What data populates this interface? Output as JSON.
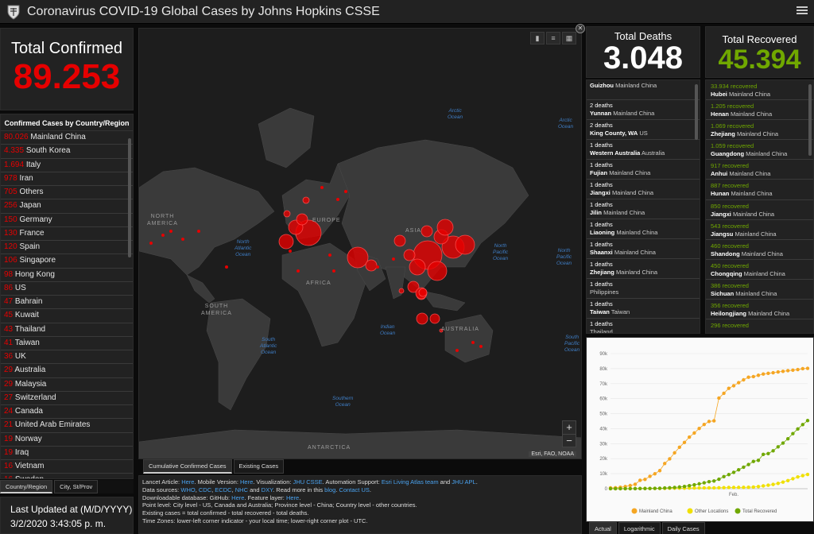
{
  "header": {
    "title": "Coronavirus COVID-19 Global Cases by Johns Hopkins CSSE",
    "menu_icon": "hamburger-icon"
  },
  "total_confirmed": {
    "label": "Total Confirmed",
    "value": "89.253"
  },
  "country_list": {
    "header": "Confirmed Cases by Country/Region",
    "items": [
      {
        "count": "80.026",
        "name": "Mainland China"
      },
      {
        "count": "4.335",
        "name": "South Korea"
      },
      {
        "count": "1.694",
        "name": "Italy"
      },
      {
        "count": "978",
        "name": "Iran"
      },
      {
        "count": "705",
        "name": "Others"
      },
      {
        "count": "256",
        "name": "Japan"
      },
      {
        "count": "150",
        "name": "Germany"
      },
      {
        "count": "130",
        "name": "France"
      },
      {
        "count": "120",
        "name": "Spain"
      },
      {
        "count": "106",
        "name": "Singapore"
      },
      {
        "count": "98",
        "name": "Hong Kong"
      },
      {
        "count": "86",
        "name": "US"
      },
      {
        "count": "47",
        "name": "Bahrain"
      },
      {
        "count": "45",
        "name": "Kuwait"
      },
      {
        "count": "43",
        "name": "Thailand"
      },
      {
        "count": "41",
        "name": "Taiwan"
      },
      {
        "count": "36",
        "name": "UK"
      },
      {
        "count": "29",
        "name": "Australia"
      },
      {
        "count": "29",
        "name": "Malaysia"
      },
      {
        "count": "27",
        "name": "Switzerland"
      },
      {
        "count": "24",
        "name": "Canada"
      },
      {
        "count": "21",
        "name": "United Arab Emirates"
      },
      {
        "count": "19",
        "name": "Norway"
      },
      {
        "count": "19",
        "name": "Iraq"
      },
      {
        "count": "16",
        "name": "Vietnam"
      },
      {
        "count": "16",
        "name": "Sweden"
      }
    ]
  },
  "left_tabs": [
    "Country/Region",
    "City, St/Prov"
  ],
  "last_updated": {
    "label": "Last Updated at (M/D/YYYY)",
    "value": "3/2/2020 3:43:05 p. m."
  },
  "map": {
    "labels": {
      "north_america": "NORTH\nAMERICA",
      "south_america": "SOUTH\nAMERICA",
      "europe": "EUROPE",
      "africa": "AFRICA",
      "asia": "ASIA",
      "australia": "AUSTRALIA",
      "antarctica": "ANTARCTICA"
    },
    "oceans": {
      "arctic": "Arctic\nOcean",
      "arctic_right": "Arctic\nOcean",
      "north_atlantic": "North\nAtlantic\nOcean",
      "north_pacific": "North\nPacific\nOcean",
      "north_pacific_right": "North\nPacific\nOcean",
      "indian": "Indian\nOcean",
      "south_atlantic": "South\nAtlantic\nOcean",
      "south_pacific": "South\nPacific\nOcean",
      "southern": "Southern\nOcean"
    },
    "attribution": "Esri, FAO, NOAA",
    "zoom_in": "+",
    "zoom_out": "−",
    "close": "✕",
    "tools": [
      "bookmark-icon",
      "list-icon",
      "grid-icon"
    ]
  },
  "map_tabs": [
    "Cumulative Confirmed Cases",
    "Existing Cases"
  ],
  "info": {
    "line1_prefix": "Lancet Article: ",
    "line1_here1": "Here",
    "line1_mid1": ". Mobile Version: ",
    "line1_here2": "Here",
    "line1_mid2": ". Visualization: ",
    "line1_jhu": "JHU CSSE",
    "line1_mid3": ". Automation Support: ",
    "line1_esri": "Esri Living Atlas team",
    "line1_and": " and ",
    "line1_apl": "JHU APL",
    "line1_end": ".",
    "line2_prefix": "Data sources: ",
    "line2_who": "WHO",
    "line2_cdc": "CDC",
    "line2_ecdc": "ECDC",
    "line2_nhc": "NHC",
    "line2_dxy": "DXY",
    "line2_mid": ". Read more in this ",
    "line2_blog": "blog",
    "line2_mid2": ". ",
    "line2_contact": "Contact US",
    "line2_end": ".",
    "line3_prefix": "Downloadable database: GitHub: ",
    "line3_here": "Here",
    "line3_mid": ". Feature layer: ",
    "line3_here2": "Here",
    "line3_end": ".",
    "line4": "Point level: City level - US, Canada and Australia; Province level - China; Country level - other countries.",
    "line5": "Existing cases = total confirmed - total recovered - total deaths.",
    "line6": "Time Zones: lower-left corner indicator - your local time; lower-right corner plot - UTC."
  },
  "total_deaths": {
    "label": "Total Deaths",
    "value": "3.048"
  },
  "deaths_list": [
    {
      "count": "",
      "place": "Guizhou",
      "region": "Mainland China"
    },
    {
      "count": "2 deaths",
      "place": "Yunnan",
      "region": "Mainland China"
    },
    {
      "count": "2 deaths",
      "place": "King County, WA",
      "region": "US"
    },
    {
      "count": "1 deaths",
      "place": "Western Australia",
      "region": "Australia"
    },
    {
      "count": "1 deaths",
      "place": "Fujian",
      "region": "Mainland China"
    },
    {
      "count": "1 deaths",
      "place": "Jiangxi",
      "region": "Mainland China"
    },
    {
      "count": "1 deaths",
      "place": "Jilin",
      "region": "Mainland China"
    },
    {
      "count": "1 deaths",
      "place": "Liaoning",
      "region": "Mainland China"
    },
    {
      "count": "1 deaths",
      "place": "Shaanxi",
      "region": "Mainland China"
    },
    {
      "count": "1 deaths",
      "place": "Zhejiang",
      "region": "Mainland China"
    },
    {
      "count": "1 deaths",
      "place": "",
      "region": "Philippines"
    },
    {
      "count": "1 deaths",
      "place": "Taiwan",
      "region": "Taiwan"
    },
    {
      "count": "1 deaths",
      "place": "",
      "region": "Thailand"
    }
  ],
  "total_recovered": {
    "label": "Total Recovered",
    "value": "45.394"
  },
  "recovered_list": [
    {
      "count": "33.934 recovered",
      "place": "Hubei",
      "region": "Mainland China"
    },
    {
      "count": "1.205 recovered",
      "place": "Henan",
      "region": "Mainland China"
    },
    {
      "count": "1.069 recovered",
      "place": "Zhejiang",
      "region": "Mainland China"
    },
    {
      "count": "1.059 recovered",
      "place": "Guangdong",
      "region": "Mainland China"
    },
    {
      "count": "917 recovered",
      "place": "Anhui",
      "region": "Mainland China"
    },
    {
      "count": "887 recovered",
      "place": "Hunan",
      "region": "Mainland China"
    },
    {
      "count": "850 recovered",
      "place": "Jiangxi",
      "region": "Mainland China"
    },
    {
      "count": "543 recovered",
      "place": "Jiangsu",
      "region": "Mainland China"
    },
    {
      "count": "460 recovered",
      "place": "Shandong",
      "region": "Mainland China"
    },
    {
      "count": "450 recovered",
      "place": "Chongqing",
      "region": "Mainland China"
    },
    {
      "count": "386 recovered",
      "place": "Sichuan",
      "region": "Mainland China"
    },
    {
      "count": "356 recovered",
      "place": "Heilongjiang",
      "region": "Mainland China"
    },
    {
      "count": "296 recovered",
      "place": "",
      "region": ""
    }
  ],
  "chart_tabs": [
    "Actual",
    "Logarithmic",
    "Daily Cases"
  ],
  "chart_data": {
    "type": "line",
    "xlabel": "",
    "ylabel": "",
    "x_tick_labels": [
      "Feb."
    ],
    "y_tick_labels": [
      "0",
      "10k",
      "20k",
      "30k",
      "40k",
      "50k",
      "60k",
      "70k",
      "80k",
      "90k"
    ],
    "ylim": [
      0,
      90000
    ],
    "legend_position": "bottom",
    "series": [
      {
        "name": "Mainland China",
        "color": "#f5a623",
        "values": [
          555,
          653,
          941,
          1438,
          2118,
          2927,
          5578,
          6165,
          8235,
          9925,
          12038,
          16787,
          19881,
          23892,
          27636,
          30818,
          34392,
          37121,
          40151,
          42763,
          44803,
          45222,
          60370,
          63581,
          66887,
          68584,
          70644,
          72533,
          74278,
          74675,
          75569,
          76392,
          76846,
          77262,
          77779,
          78190,
          78630,
          78959,
          79389,
          79968,
          80174
        ]
      },
      {
        "name": "Other Locations",
        "color": "#f0e000",
        "values": [
          9,
          15,
          39,
          60,
          70,
          106,
          132,
          146,
          153,
          159,
          191,
          204,
          288,
          330,
          354,
          382,
          461,
          503,
          526,
          548,
          554,
          574,
          642,
          716,
          802,
          839,
          858,
          865,
          967,
          1083,
          1395,
          1857,
          2327,
          2850,
          3539,
          4422,
          5398,
          6670,
          7833,
          8720,
          9500
        ]
      },
      {
        "name": "Total Recovered",
        "color": "#70a800",
        "values": [
          28,
          30,
          36,
          39,
          52,
          61,
          107,
          126,
          143,
          222,
          284,
          472,
          623,
          852,
          1124,
          1487,
          2011,
          2616,
          3244,
          3946,
          4683,
          5150,
          6295,
          8058,
          9395,
          10865,
          12583,
          14352,
          16121,
          18177,
          18890,
          22886,
          23394,
          25227,
          27905,
          30384,
          33277,
          36711,
          39782,
          42716,
          45394
        ]
      }
    ]
  }
}
